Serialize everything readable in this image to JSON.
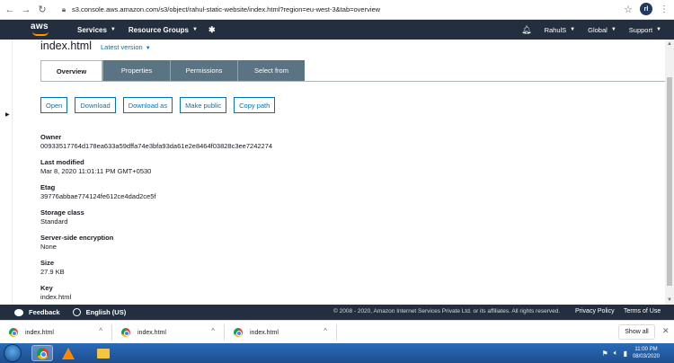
{
  "browser": {
    "back": "←",
    "forward": "→",
    "reload": "C",
    "url": "s3.console.aws.amazon.com/s3/object/rahul-static-website/index.html?region=eu-west-3&tab=overview",
    "profile_initials": "rl"
  },
  "header": {
    "logo_text": "aws",
    "services": "Services",
    "resource_groups": "Resource Groups",
    "user": "RahulS",
    "region": "Global",
    "support": "Support"
  },
  "object": {
    "title": "index.html",
    "version": "Latest version"
  },
  "tabs": [
    {
      "label": "Overview"
    },
    {
      "label": "Properties"
    },
    {
      "label": "Permissions"
    },
    {
      "label": "Select from"
    }
  ],
  "actions": {
    "open": "Open",
    "download": "Download",
    "download_as": "Download as",
    "make_public": "Make public",
    "copy_path": "Copy path"
  },
  "fields": [
    {
      "label": "Owner",
      "value": "00933517764d178ea633a59dffa74e3bfa93da61e2e8464f03828c3ee7242274"
    },
    {
      "label": "Last modified",
      "value": "Mar 8, 2020 11:01:11 PM GMT+0530"
    },
    {
      "label": "Etag",
      "value": "39776abbae774124fe612ce4dad2ce5f"
    },
    {
      "label": "Storage class",
      "value": "Standard"
    },
    {
      "label": "Server-side encryption",
      "value": "None"
    },
    {
      "label": "Size",
      "value": "27.9 KB"
    },
    {
      "label": "Key",
      "value": "index.html"
    }
  ],
  "footer": {
    "feedback": "Feedback",
    "language": "English (US)",
    "copyright": "© 2008 - 2020, Amazon Internet Services Private Ltd. or its affiliates. All rights reserved.",
    "privacy": "Privacy Policy",
    "terms": "Terms of Use"
  },
  "downloads": {
    "items": [
      {
        "name": "index.html"
      },
      {
        "name": "index.html"
      },
      {
        "name": "index.html"
      }
    ],
    "show_all": "Show all"
  },
  "taskbar": {
    "time": "11:00 PM",
    "date": "08/03/2020"
  },
  "colors": {
    "aws_navy": "#232f3e",
    "aws_orange": "#ff9900",
    "link_blue": "#0073bb",
    "tab_inactive": "#5a7483"
  }
}
